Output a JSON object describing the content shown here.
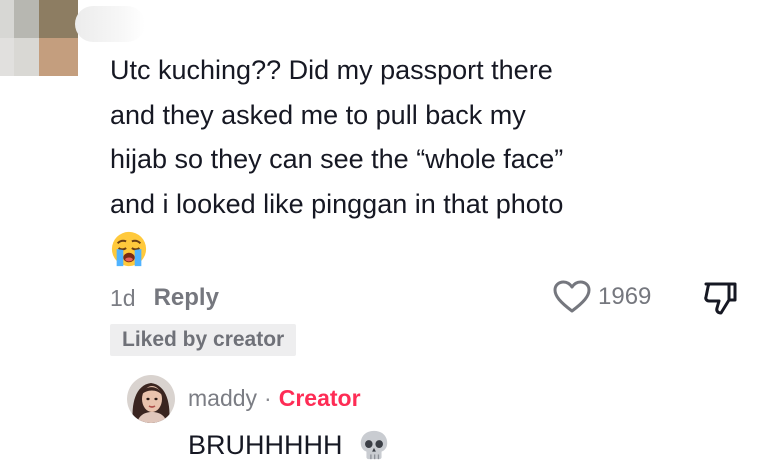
{
  "comment": {
    "text": "Utc kuching?? Did my passport there\nand they asked me to pull back my\nhijab so they can see the “whole face”\nand i looked like pinggan in that photo",
    "emoji": "crying-face",
    "time_ago": "1d",
    "reply_label": "Reply",
    "like_count": "1969",
    "liked_by_creator": "Liked by creator"
  },
  "reply": {
    "username": "maddy",
    "separator": "·",
    "creator_label": "Creator",
    "text": "BRUHHHHH",
    "emoji": "skull"
  },
  "colors": {
    "text": "#161823",
    "muted": "#75777e",
    "creator": "#fe2c55",
    "badge_bg": "#eeeeef"
  },
  "icons": {
    "like": "heart-outline-icon",
    "dislike": "thumbs-down-icon"
  }
}
